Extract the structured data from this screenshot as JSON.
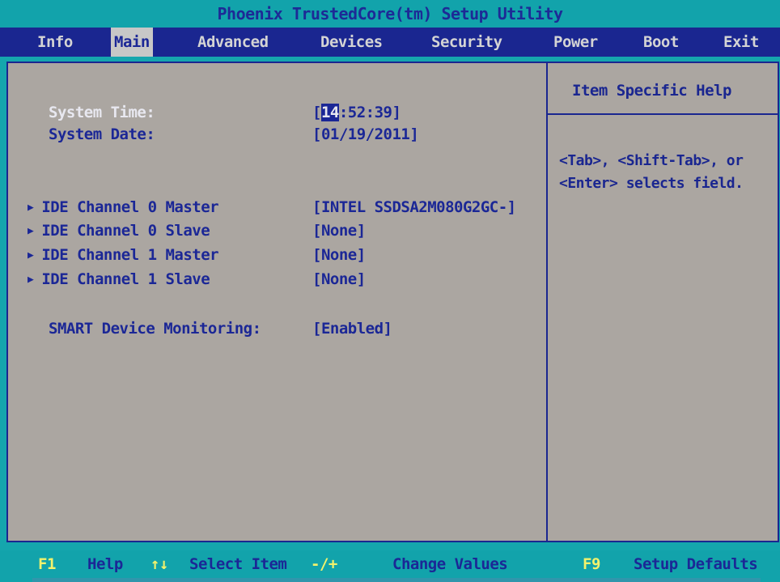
{
  "title": "Phoenix TrustedCore(tm) Setup Utility",
  "menu": [
    {
      "label": "Info"
    },
    {
      "label": "Main"
    },
    {
      "label": "Advanced"
    },
    {
      "label": "Devices"
    },
    {
      "label": "Security"
    },
    {
      "label": "Power"
    },
    {
      "label": "Boot"
    },
    {
      "label": "Exit"
    }
  ],
  "active_menu": "Main",
  "settings": {
    "system_time": {
      "label": "System Time:",
      "prefix": "[",
      "hour": "14",
      "rest": ":52:39]"
    },
    "system_date": {
      "label": "System Date:",
      "value": "[01/19/2011]"
    },
    "ide": [
      {
        "label": "IDE Channel 0 Master",
        "value": "[INTEL SSDSA2M080G2GC-]"
      },
      {
        "label": "IDE Channel 0 Slave",
        "value": "[None]"
      },
      {
        "label": "IDE Channel 1 Master",
        "value": "[None]"
      },
      {
        "label": "IDE Channel 1 Slave",
        "value": "[None]"
      }
    ],
    "smart": {
      "label": "SMART Device Monitoring:",
      "value": "[Enabled]"
    },
    "submenu_arrow_icon": "triangle-right"
  },
  "help": {
    "title": "Item Specific Help",
    "lines": [
      "<Tab>, <Shift-Tab>, or",
      "<Enter> selects field."
    ]
  },
  "footer": [
    {
      "key": "F1",
      "desc": "Help"
    },
    {
      "key": "↑↓",
      "desc": "Select Item"
    },
    {
      "key": "-/+",
      "desc": "Change Values"
    },
    {
      "key": "F9",
      "desc": "Setup Defaults"
    }
  ],
  "colors": {
    "frame": "#15a6ad",
    "menubar": "#1a2690",
    "panel": "#aba6a1",
    "text": "#1b2796",
    "highlight": "#e8e8f0",
    "key": "#f2f26c"
  }
}
